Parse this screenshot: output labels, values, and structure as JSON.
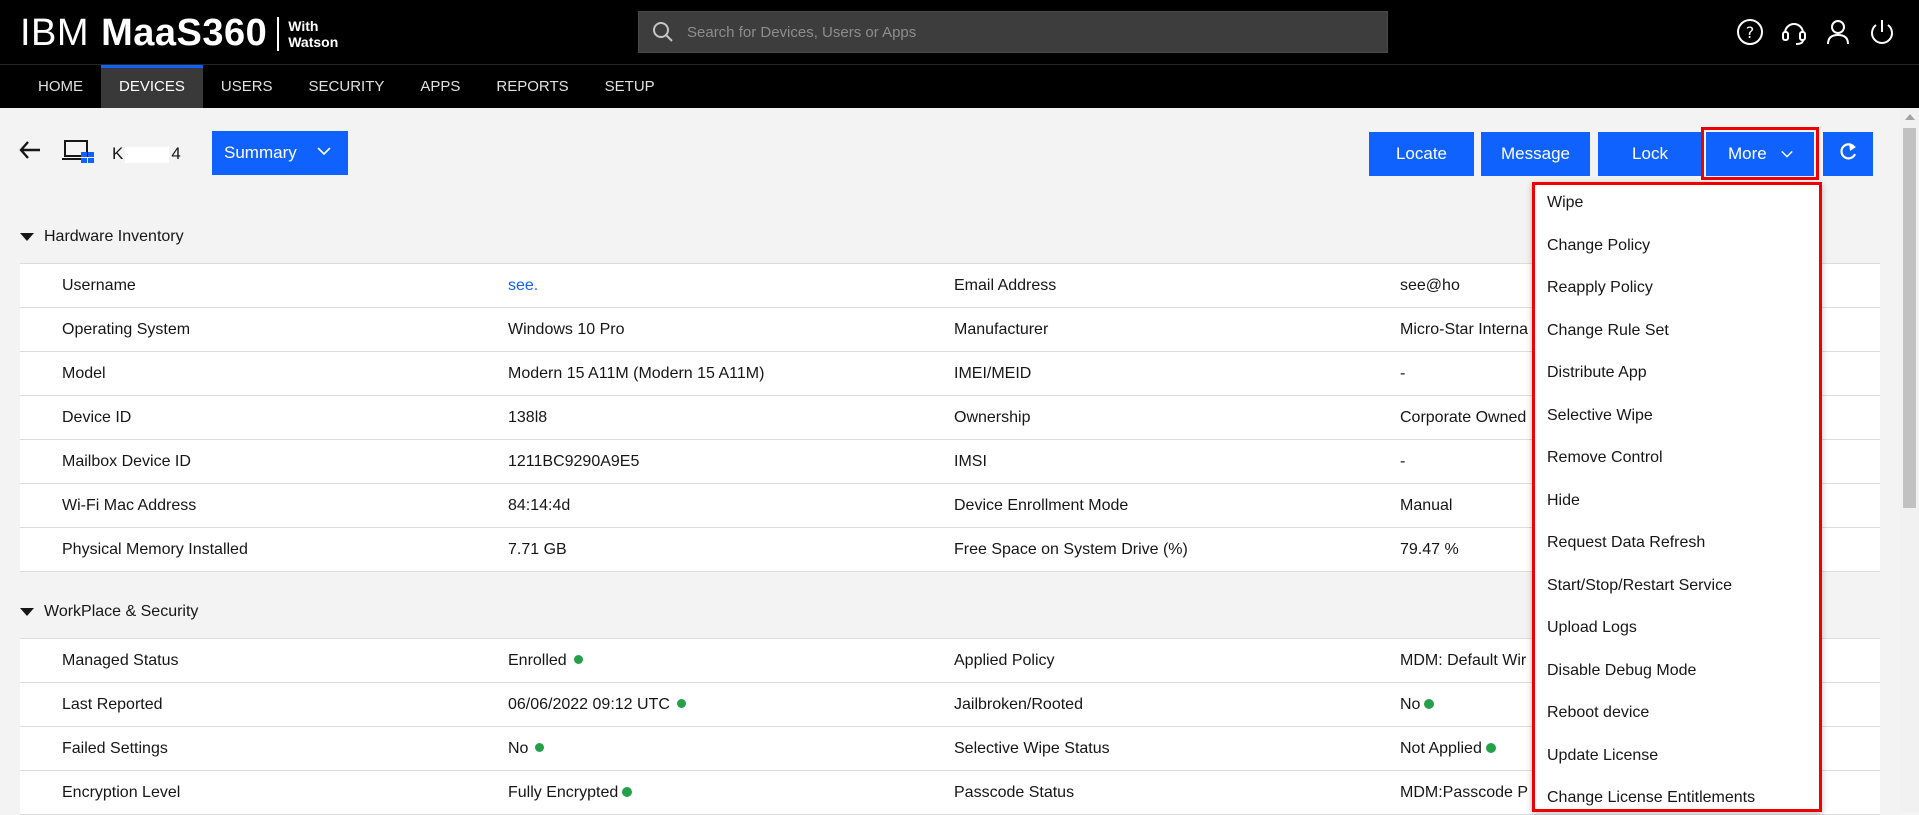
{
  "brand": {
    "ibm": "IBM",
    "product": "MaaS360",
    "with": "With",
    "watson": "Watson"
  },
  "search": {
    "placeholder": "Search for Devices, Users or Apps"
  },
  "top_icons": [
    "help-icon",
    "support-headset-icon",
    "user-icon",
    "power-icon"
  ],
  "nav": {
    "items": [
      "HOME",
      "DEVICES",
      "USERS",
      "SECURITY",
      "APPS",
      "REPORTS",
      "SETUP"
    ],
    "active": "DEVICES"
  },
  "device": {
    "name_prefix": "K",
    "name_suffix": "4"
  },
  "view_select": {
    "label": "Summary"
  },
  "actions": {
    "locate": "Locate",
    "message": "Message",
    "lock": "Lock",
    "more": "More"
  },
  "sections": {
    "hardware": {
      "title": "Hardware Inventory",
      "rows": [
        [
          "Username",
          "see.",
          "Email Address",
          "see@ho"
        ],
        [
          "Operating System",
          "Windows 10 Pro",
          "Manufacturer",
          "Micro-Star Interna"
        ],
        [
          "Model",
          "Modern 15 A11M (Modern 15 A11M)",
          "IMEI/MEID",
          "-"
        ],
        [
          "Device ID",
          "138l8",
          "Ownership",
          "Corporate Owned"
        ],
        [
          "Mailbox Device ID",
          "1211BC9290A9E5",
          "IMSI",
          "-"
        ],
        [
          "Wi-Fi Mac Address",
          "84:14:4d",
          "Device Enrollment Mode",
          "Manual"
        ],
        [
          "Physical Memory Installed",
          "7.71 GB",
          "Free Space on System Drive (%)",
          "79.47 %"
        ]
      ]
    },
    "workplace": {
      "title": "WorkPlace & Security",
      "rows": [
        [
          "Managed Status",
          "Enrolled",
          "Applied Policy",
          "MDM: Default Wir"
        ],
        [
          "Last Reported",
          "06/06/2022 09:12 UTC",
          "Jailbroken/Rooted",
          "No"
        ],
        [
          "Failed Settings",
          "No",
          "Selective Wipe Status",
          "Not Applied"
        ],
        [
          "Encryption Level",
          "Fully Encrypted",
          "Passcode Status",
          "MDM:Passcode P"
        ]
      ]
    }
  },
  "more_menu": [
    "Wipe",
    "Change Policy",
    "Reapply Policy",
    "Change Rule Set",
    "Distribute App",
    "Selective Wipe",
    "Remove Control",
    "Hide",
    "Request Data Refresh",
    "Start/Stop/Restart Service",
    "Upload Logs",
    "Disable Debug Mode",
    "Reboot device",
    "Update License",
    "Change License Entitlements"
  ],
  "colors": {
    "accent": "#0f62fe",
    "highlight": "#ee0000",
    "status_ok": "#24a148"
  }
}
